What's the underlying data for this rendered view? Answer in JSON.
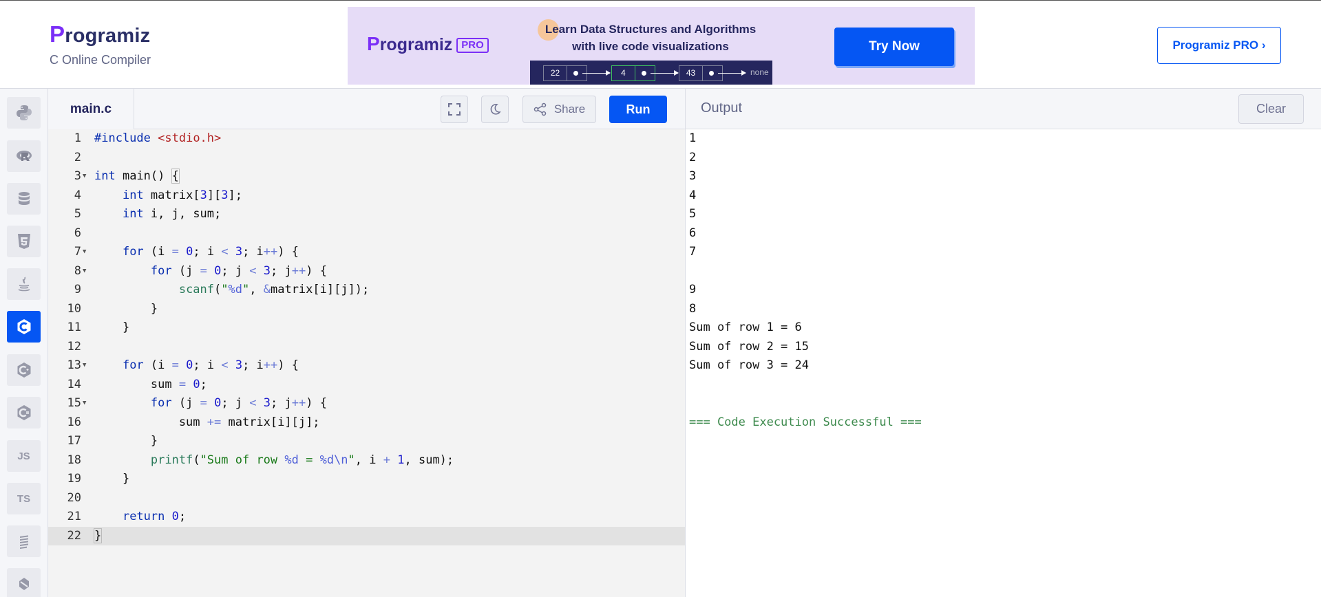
{
  "header": {
    "logo_text": "rogramiz",
    "logo_initial": "P",
    "subtitle": "C Online Compiler",
    "pro_button": "Programiz PRO ›"
  },
  "banner": {
    "logo_initial": "P",
    "logo_text": "rogramiz",
    "pro_tag": "PRO",
    "line1": "Learn Data Structures and Algorithms",
    "line2": "with live code visualizations",
    "cta": "Try Now",
    "nodes": [
      "22",
      "4",
      "43"
    ],
    "none_label": "none"
  },
  "sidebar": {
    "items": [
      {
        "name": "python",
        "icon": "python-icon",
        "label": ""
      },
      {
        "name": "r",
        "icon": "r-icon",
        "label": ""
      },
      {
        "name": "sql",
        "icon": "database-icon",
        "label": ""
      },
      {
        "name": "html",
        "icon": "html5-icon",
        "label": ""
      },
      {
        "name": "java",
        "icon": "java-icon",
        "label": ""
      },
      {
        "name": "c",
        "icon": "c-icon",
        "label": "",
        "active": true
      },
      {
        "name": "cpp",
        "icon": "cpp-icon",
        "label": ""
      },
      {
        "name": "csharp",
        "icon": "csharp-icon",
        "label": ""
      },
      {
        "name": "javascript",
        "icon": "js-icon",
        "label": "JS"
      },
      {
        "name": "typescript",
        "icon": "ts-icon",
        "label": "TS"
      },
      {
        "name": "swift",
        "icon": "swift-icon",
        "label": ""
      },
      {
        "name": "go",
        "icon": "go-icon",
        "label": ""
      }
    ]
  },
  "editor": {
    "filename": "main.c",
    "share_label": "Share",
    "run_label": "Run",
    "current_line": 22,
    "lines": [
      "#include <stdio.h>",
      "",
      "int main() {",
      "    int matrix[3][3];",
      "    int i, j, sum;",
      "",
      "    for (i = 0; i < 3; i++) {",
      "        for (j = 0; j < 3; j++) {",
      "            scanf(\"%d\", &matrix[i][j]);",
      "        }",
      "    }",
      "",
      "    for (i = 0; i < 3; i++) {",
      "        sum = 0;",
      "        for (j = 0; j < 3; j++) {",
      "            sum += matrix[i][j];",
      "        }",
      "        printf(\"Sum of row %d = %d\\n\", i + 1, sum);",
      "    }",
      "",
      "    return 0;",
      "}"
    ],
    "fold_lines": [
      3,
      7,
      8,
      13,
      15
    ]
  },
  "output": {
    "title": "Output",
    "clear_label": "Clear",
    "lines": [
      "1",
      "2",
      "3",
      "4",
      "5",
      "6",
      "7",
      "",
      "9",
      "8",
      "Sum of row 1 = 6",
      "Sum of row 2 = 15",
      "Sum of row 3 = 24",
      "",
      "",
      "=== Code Execution Successful ==="
    ]
  },
  "colors": {
    "accent": "#0556f3",
    "brand_purple": "#7b2ff7",
    "banner_bg": "#e6dcf7",
    "success": "#3d8a4d"
  }
}
